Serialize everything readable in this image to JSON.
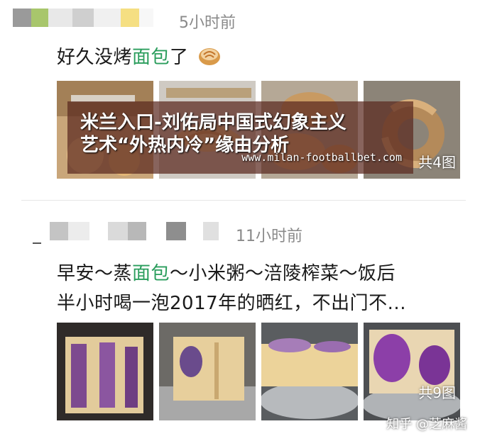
{
  "posts": [
    {
      "time": "5小时前",
      "text_before": "好久没烤",
      "text_highlight": "面包",
      "text_after": "了",
      "emoji_icon": "bread-emoji-icon",
      "image_count": "共4图"
    },
    {
      "time": "11小时前",
      "line1_before": "早安～蒸",
      "line1_highlight": "面包",
      "line1_after": "～小米粥～涪陵榨菜～饭后",
      "line2": "半小时喝一泡2017年的晒红，不出门不...",
      "image_count": "共9图"
    }
  ],
  "watermark": {
    "title_line1": "米兰入口-刘佑局中国式幻象主义",
    "title_line2": "艺术“外热内冷”缘由分析",
    "url": "www.milan-footballbet.com"
  },
  "credit": "知乎 @芝麻酱",
  "colors": {
    "highlight": "#2a9d5c",
    "time": "#8a8a8a",
    "text": "#1a1a1a"
  }
}
